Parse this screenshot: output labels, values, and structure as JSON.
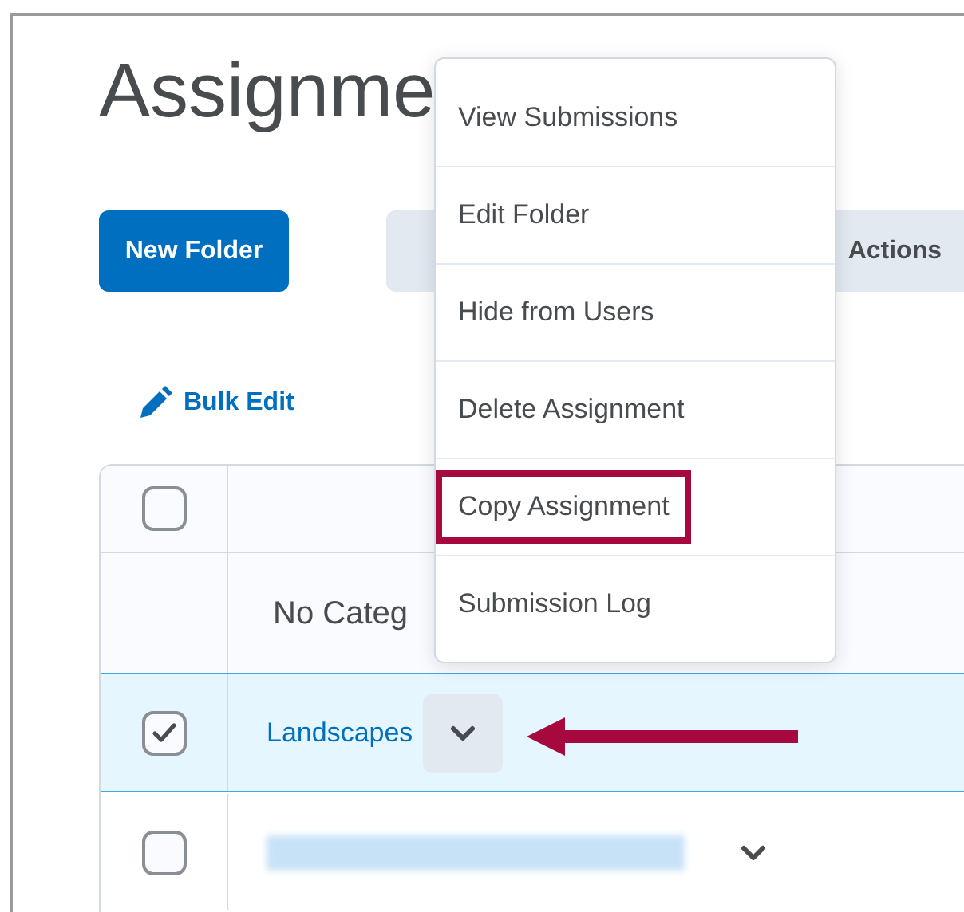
{
  "page": {
    "title": "Assignme"
  },
  "buttons": [
    {
      "label": "New Folder",
      "kind": "primary"
    },
    {
      "label": "Actions",
      "kind": "secondary"
    }
  ],
  "bulk_edit": {
    "label": "Bulk Edit"
  },
  "table": {
    "header_checked": false,
    "category": "No Categ",
    "rows": [
      {
        "kind": "link",
        "title": "Landscapes",
        "checked": true,
        "selected": true,
        "menu_open": true
      },
      {
        "kind": "blurred",
        "checked": false,
        "selected": false,
        "menu_open": false
      }
    ]
  },
  "menu": {
    "items": [
      {
        "label": "View Submissions",
        "highlighted": false
      },
      {
        "label": "Edit Folder",
        "highlighted": false
      },
      {
        "label": "Hide from Users",
        "highlighted": false
      },
      {
        "label": "Delete Assignment",
        "highlighted": false
      },
      {
        "label": "Copy Assignment",
        "highlighted": true
      },
      {
        "label": "Submission Log",
        "highlighted": false
      }
    ]
  }
}
